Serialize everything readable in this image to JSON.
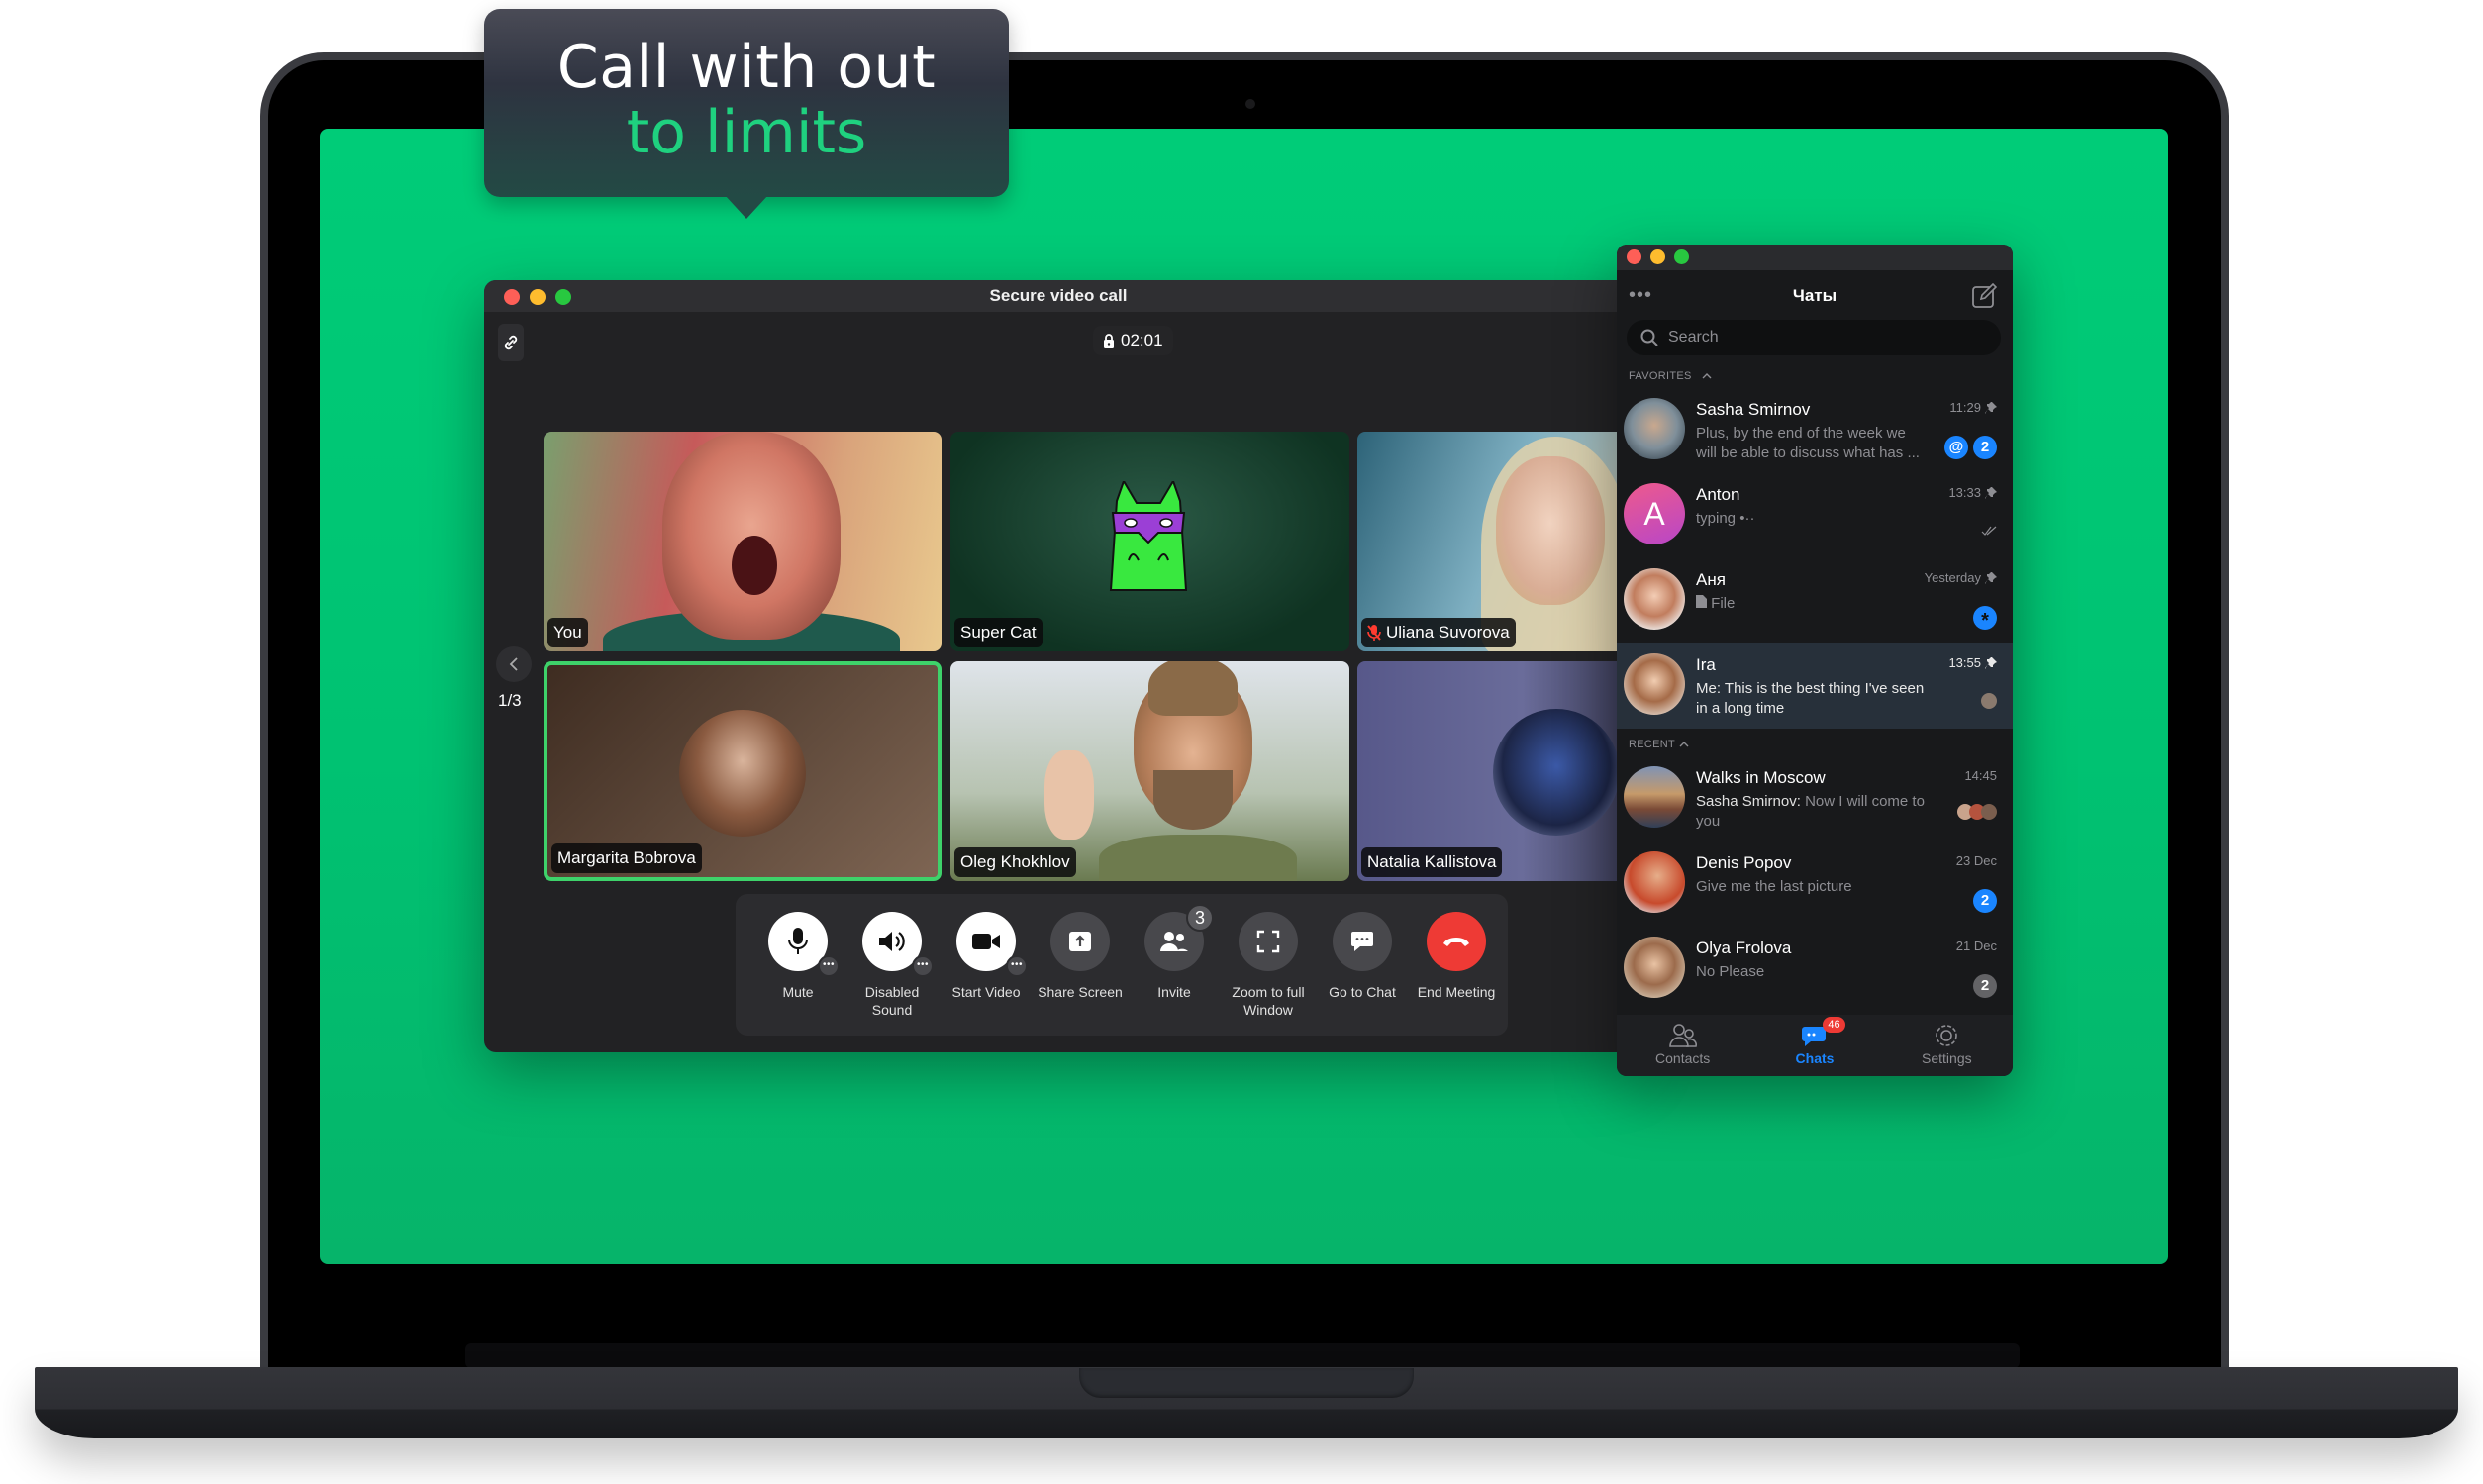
{
  "promo": {
    "line1": "Call with out",
    "line2": "to limits",
    "accent_color": "#1fd17f"
  },
  "video_call": {
    "window_title": "Secure video call",
    "timer": "02:01",
    "lock_icon": "lock-icon",
    "link_icon": "link-icon",
    "page_indicator": "1/3",
    "participants": [
      {
        "name": "You",
        "muted": false,
        "speaking": false
      },
      {
        "name": "Super Cat",
        "muted": false,
        "speaking": false
      },
      {
        "name": "Uliana Suvorova",
        "muted": true,
        "speaking": false
      },
      {
        "name": "Margarita Bobrova",
        "muted": false,
        "speaking": true
      },
      {
        "name": "Oleg Khokhlov",
        "muted": false,
        "speaking": false
      },
      {
        "name": "Natalia Kallistova",
        "muted": false,
        "speaking": false
      }
    ],
    "controls": [
      {
        "label": "Mute",
        "icon": "microphone-icon",
        "has_more": true
      },
      {
        "label": "Disabled Sound",
        "icon": "speaker-icon",
        "has_more": true
      },
      {
        "label": "Start Video",
        "icon": "camera-icon",
        "has_more": true
      },
      {
        "label": "Share Screen",
        "icon": "share-screen-icon",
        "has_more": false
      },
      {
        "label": "Invite",
        "icon": "users-icon",
        "badge": "3"
      },
      {
        "label": "Zoom to full Window",
        "icon": "fullscreen-icon",
        "has_more": false
      },
      {
        "label": "Go to Chat",
        "icon": "chat-bubble-icon",
        "has_more": false
      },
      {
        "label": "End Meeting",
        "icon": "hang-up-icon",
        "has_more": false
      }
    ],
    "more_label": "•••",
    "speaking_color": "#3ed26a",
    "end_color": "#ee3a35"
  },
  "chat_panel": {
    "title": "Чаты",
    "menu_dots": "•••",
    "search_placeholder": "Search",
    "favorites_label": "FAVORITES",
    "recent_label": "RECENT",
    "favorites": [
      {
        "name": "Sasha Smirnov",
        "time": "11:29",
        "pinned": true,
        "message": "Plus, by the end of the week we will be able to discuss what has ...",
        "mention": "@",
        "unread": "2"
      },
      {
        "name": "Anton",
        "time": "13:33",
        "pinned": true,
        "message": "typing •··",
        "avatar_letter": "A",
        "read": true
      },
      {
        "name": "Аня",
        "time": "Yesterday",
        "pinned": true,
        "message": "File",
        "badge": "*"
      },
      {
        "name": "Ira",
        "time": "13:55",
        "pinned": true,
        "message": "Me: This is the best thing I've seen in a long time",
        "active": true
      }
    ],
    "recent": [
      {
        "name": "Walks in Moscow",
        "time": "14:45",
        "sender": "Sasha Smirnov:",
        "message": "Now I will come to you"
      },
      {
        "name": "Denis Popov",
        "time": "23 Dec",
        "message": "Give me the last picture",
        "unread": "2"
      },
      {
        "name": "Olya Frolova",
        "time": "21 Dec",
        "message": "No Please",
        "unread": "2"
      }
    ],
    "tabs": [
      {
        "label": "Contacts",
        "icon": "contacts-icon",
        "active": false
      },
      {
        "label": "Chats",
        "icon": "chats-icon",
        "active": true,
        "badge": "46"
      },
      {
        "label": "Settings",
        "icon": "settings-gear-icon",
        "active": false
      }
    ],
    "accent_color": "#1a85ff"
  }
}
